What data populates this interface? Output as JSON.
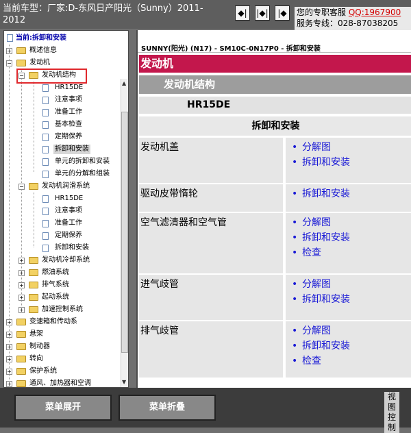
{
  "header": {
    "car_info_line1": "当前车型：厂家:D-东风日产阳光（Sunny）2011-",
    "car_info_line2": "2012",
    "nav_buttons": [
      "◆|",
      "|◆|",
      "|◆"
    ],
    "service_label": "您的专职客服",
    "service_qq": "QQ:1967900",
    "service_phone": "服务专线：028-87038205"
  },
  "tree": {
    "current": "当前:拆卸和安装",
    "items": [
      {
        "label": "概述信息"
      },
      {
        "label": "发动机"
      },
      {
        "label": "发动机结构"
      },
      {
        "label": "HR15DE"
      },
      {
        "label": "注意事项"
      },
      {
        "label": "准备工作"
      },
      {
        "label": "基本检查"
      },
      {
        "label": "定期保养"
      },
      {
        "label": "拆卸和安装"
      },
      {
        "label": "单元的拆卸和安装"
      },
      {
        "label": "单元的分解和组装"
      },
      {
        "label": "发动机润滑系统"
      },
      {
        "label": "HR15DE"
      },
      {
        "label": "注意事项"
      },
      {
        "label": "准备工作"
      },
      {
        "label": "定期保养"
      },
      {
        "label": "拆卸和安装"
      },
      {
        "label": "发动机冷却系统"
      },
      {
        "label": "燃油系统"
      },
      {
        "label": "排气系统"
      },
      {
        "label": "起动系统"
      },
      {
        "label": "加速控制系统"
      },
      {
        "label": "变速箱和传动系"
      },
      {
        "label": "悬架"
      },
      {
        "label": "制动器"
      },
      {
        "label": "转向"
      },
      {
        "label": "保护系统"
      },
      {
        "label": "通风、加热器和空调"
      }
    ]
  },
  "main": {
    "doc_header": "SUNNY(阳光) (N17) - SM10C-0N17P0 - 拆卸和安装",
    "section": "发动机",
    "subsection": "发动机结构",
    "engine": "HR15DE",
    "topic": "拆卸和安装",
    "rows": [
      {
        "name": "发动机盖",
        "links": [
          "分解图",
          "拆卸和安装"
        ]
      },
      {
        "name": "驱动皮带惰轮",
        "links": [
          "拆卸和安装"
        ]
      },
      {
        "name": "空气滤清器和空气管",
        "links": [
          "分解图",
          "拆卸和安装",
          "检查"
        ]
      },
      {
        "name": "进气歧管",
        "links": [
          "分解图",
          "拆卸和安装"
        ]
      },
      {
        "name": "排气歧管",
        "links": [
          "分解图",
          "拆卸和安装",
          "检查"
        ]
      }
    ]
  },
  "footer": {
    "expand_label": "菜单展开",
    "collapse_label": "菜单折叠",
    "view_control": [
      "视",
      "图",
      "控",
      "制"
    ]
  },
  "colors": {
    "section_red": "#c3174c",
    "link_blue": "#1a1ad6",
    "highlight_red": "#e0282c"
  }
}
